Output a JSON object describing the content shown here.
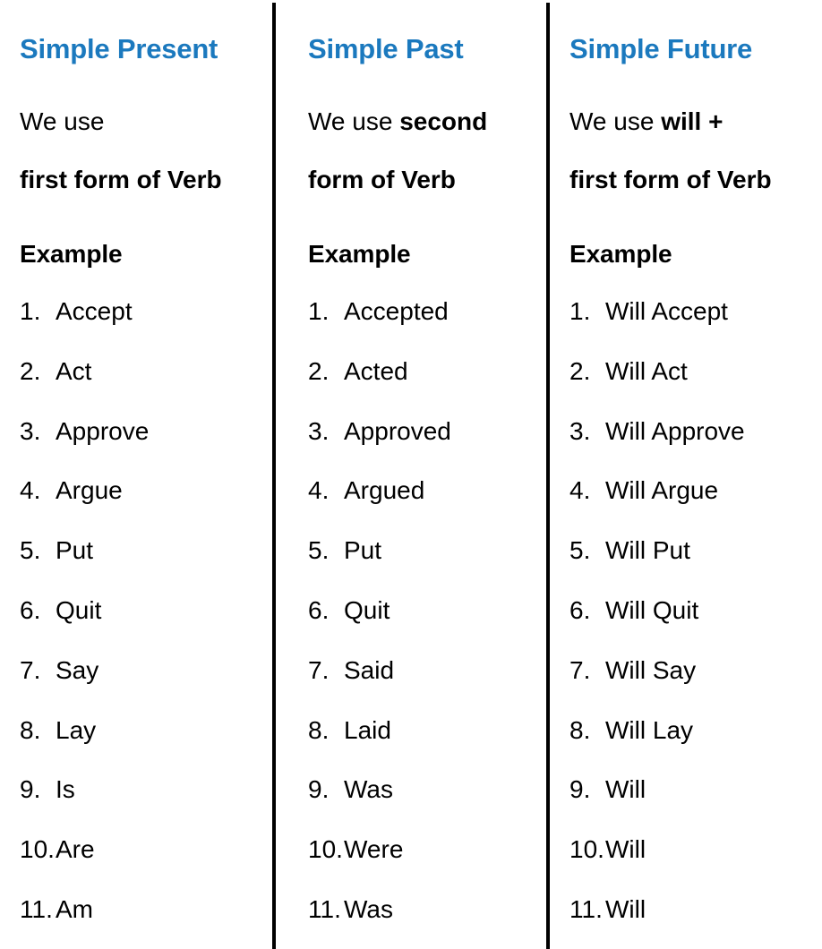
{
  "theme": {
    "heading_color": "#1B79BE",
    "text_color": "#000000",
    "background": "#ffffff",
    "divider_color": "#000000"
  },
  "columns": [
    {
      "heading": "Simple Present",
      "usage_prefix": "We use",
      "usage_emphasis": "",
      "usage_line2": "first form of Verb",
      "example_label": "Example",
      "items": [
        {
          "num": "1.",
          "text": "Accept"
        },
        {
          "num": "2.",
          "text": "Act"
        },
        {
          "num": "3.",
          "text": "Approve"
        },
        {
          "num": "4.",
          "text": "Argue"
        },
        {
          "num": "5.",
          "text": "Put"
        },
        {
          "num": "6.",
          "text": "Quit"
        },
        {
          "num": "7.",
          "text": "Say"
        },
        {
          "num": "8.",
          "text": "Lay"
        },
        {
          "num": "9.",
          "text": "Is"
        },
        {
          "num": "10.",
          "text": "Are"
        },
        {
          "num": "11.",
          "text": "Am"
        }
      ]
    },
    {
      "heading": "Simple Past",
      "usage_prefix": "We use ",
      "usage_emphasis": "second",
      "usage_line2": "form of Verb",
      "example_label": "Example",
      "items": [
        {
          "num": "1.",
          "text": "Accepted"
        },
        {
          "num": "2.",
          "text": "Acted"
        },
        {
          "num": "3.",
          "text": "Approved"
        },
        {
          "num": "4.",
          "text": "Argued"
        },
        {
          "num": "5.",
          "text": "Put"
        },
        {
          "num": "6.",
          "text": "Quit"
        },
        {
          "num": "7.",
          "text": "Said"
        },
        {
          "num": "8.",
          "text": "Laid"
        },
        {
          "num": "9.",
          "text": "Was"
        },
        {
          "num": "10.",
          "text": "Were"
        },
        {
          "num": "11.",
          "text": "Was"
        }
      ]
    },
    {
      "heading": "Simple Future",
      "usage_prefix": "We use ",
      "usage_emphasis": "will +",
      "usage_line2": "first form of Verb",
      "example_label": "Example",
      "items": [
        {
          "num": "1.",
          "text": "Will Accept"
        },
        {
          "num": "2.",
          "text": "Will Act"
        },
        {
          "num": "3.",
          "text": "Will Approve"
        },
        {
          "num": "4.",
          "text": "Will Argue"
        },
        {
          "num": "5.",
          "text": "Will Put"
        },
        {
          "num": "6.",
          "text": "Will Quit"
        },
        {
          "num": "7.",
          "text": "Will Say"
        },
        {
          "num": "8.",
          "text": "Will Lay"
        },
        {
          "num": "9.",
          "text": "Will"
        },
        {
          "num": "10.",
          "text": "Will"
        },
        {
          "num": "11.",
          "text": "Will"
        }
      ]
    }
  ]
}
